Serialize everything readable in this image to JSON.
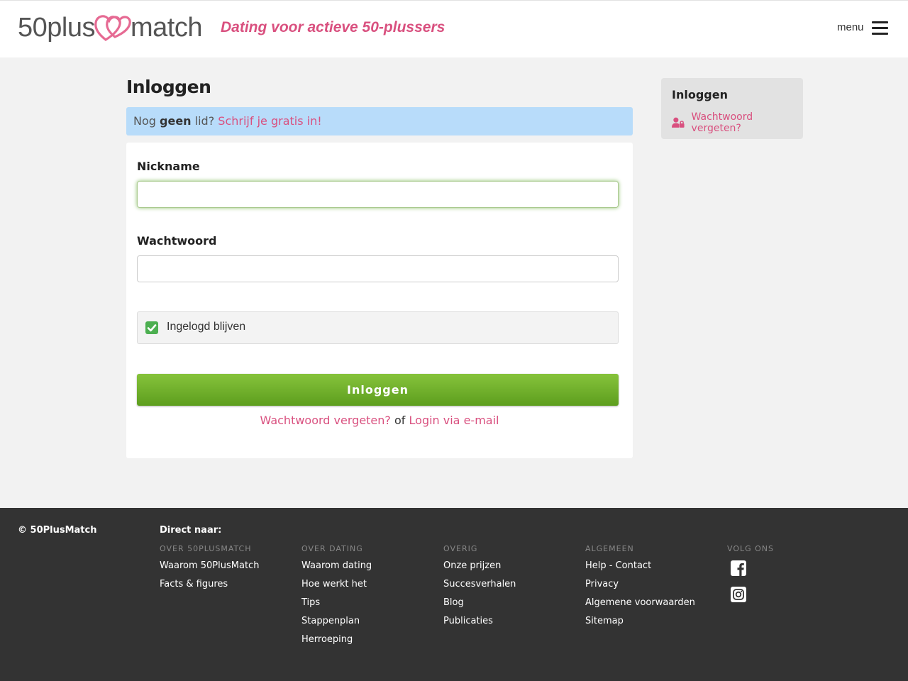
{
  "header": {
    "logo_left": "50plus",
    "logo_right": "match",
    "tagline": "Dating voor actieve 50-plussers",
    "menu_label": "menu"
  },
  "main": {
    "title": "Inloggen",
    "notice": {
      "prefix": "Nog",
      "bold": "geen",
      "suffix": "lid?",
      "link": "Schrijf je gratis in!"
    },
    "form": {
      "nickname_label": "Nickname",
      "nickname_value": "",
      "password_label": "Wachtwoord",
      "password_value": "",
      "remember_label": "Ingelogd blijven",
      "remember_checked": true,
      "submit_label": "Inloggen",
      "forgot_link": "Wachtwoord vergeten?",
      "or": "of",
      "email_login_link": "Login via e-mail"
    }
  },
  "sidebar": {
    "title": "Inloggen",
    "forgot_link": "Wachtwoord vergeten?"
  },
  "footer": {
    "copyright": "© 50PlusMatch",
    "direct": "Direct naar:",
    "columns": [
      {
        "heading": "OVER 50PLUSMATCH",
        "links": [
          "Waarom 50PlusMatch",
          "Facts & figures"
        ]
      },
      {
        "heading": "OVER DATING",
        "links": [
          "Waarom dating",
          "Hoe werkt het",
          "Tips",
          "Stappenplan",
          "Herroeping"
        ]
      },
      {
        "heading": "OVERIG",
        "links": [
          "Onze prijzen",
          "Succesverhalen",
          "Blog",
          "Publicaties"
        ]
      },
      {
        "heading": "ALGEMEEN",
        "links": [
          "Help - Contact",
          "Privacy",
          "Algemene voorwaarden",
          "Sitemap"
        ]
      },
      {
        "heading": "VOLG ONS",
        "icons": [
          "facebook-icon",
          "instagram-icon"
        ]
      }
    ]
  },
  "colors": {
    "brand_pink": "#d9507f",
    "button_green": "#6fae2b",
    "notice_blue": "#b8dcfa",
    "footer_bg": "#333333"
  }
}
